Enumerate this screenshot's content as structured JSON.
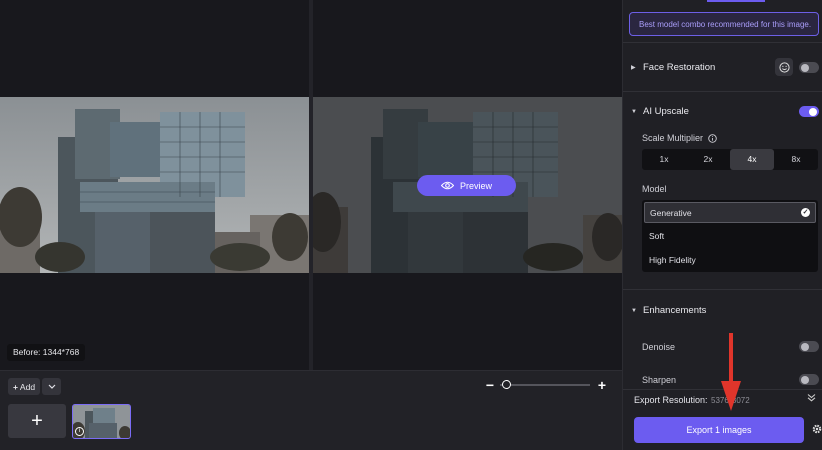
{
  "viewer": {
    "preview_label": "Preview",
    "before_tag": "Before: 1344*768"
  },
  "filmstrip": {
    "add_label": "Add",
    "add_tile_label": "+",
    "zoom_minus": "−",
    "zoom_plus": "+"
  },
  "panel": {
    "recommend_text": "Best model combo recommended for this image.",
    "face_restoration": {
      "label": "Face Restoration",
      "enabled": false
    },
    "ai_upscale": {
      "label": "AI Upscale",
      "enabled": true,
      "scale_label": "Scale Multiplier",
      "scale_options": [
        "1x",
        "2x",
        "4x",
        "8x"
      ],
      "scale_selected": "4x",
      "model_label": "Model",
      "models": [
        "Generative",
        "Soft",
        "High Fidelity"
      ],
      "model_selected": "Generative"
    },
    "enhancements": {
      "label": "Enhancements",
      "denoise_label": "Denoise",
      "denoise_enabled": false,
      "sharpen_label": "Sharpen",
      "sharpen_enabled": false
    },
    "export_resolution_label": "Export Resolution:",
    "export_resolution_value": "5376*3072",
    "export_button": "Export 1 images"
  },
  "colors": {
    "accent": "#6c5cf0",
    "annotation_arrow": "#e0352b"
  }
}
